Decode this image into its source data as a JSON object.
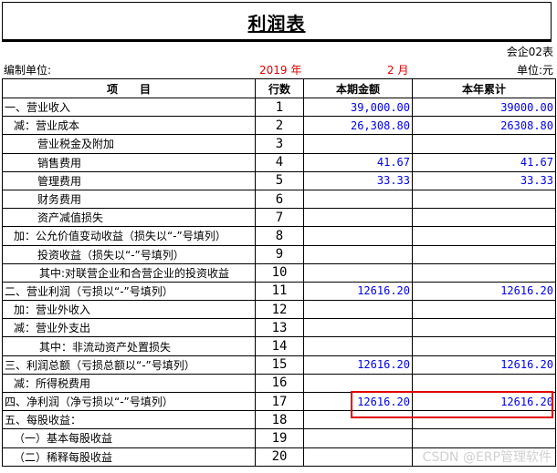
{
  "title": "利润表",
  "form_code": "会企02表",
  "meta": {
    "unit_label": "编制单位:",
    "year": "2019 年",
    "month": "2 月",
    "currency_unit": "单位:元"
  },
  "headers": [
    "项　　目",
    "行数",
    "本期金额",
    "本年累计"
  ],
  "rows": [
    {
      "item": "一、营业收入",
      "row": "1",
      "current": "39,000.00",
      "ytd": "39000.00",
      "indent": 0
    },
    {
      "item": "减：营业成本",
      "row": "2",
      "current": "26,308.80",
      "ytd": "26308.80",
      "indent": 1
    },
    {
      "item": "营业税金及附加",
      "row": "3",
      "current": "",
      "ytd": "",
      "indent": 2
    },
    {
      "item": "销售费用",
      "row": "4",
      "current": "41.67",
      "ytd": "41.67",
      "indent": 2
    },
    {
      "item": "管理费用",
      "row": "5",
      "current": "33.33",
      "ytd": "33.33",
      "indent": 2
    },
    {
      "item": "财务费用",
      "row": "6",
      "current": "",
      "ytd": "",
      "indent": 2
    },
    {
      "item": "资产减值损失",
      "row": "7",
      "current": "",
      "ytd": "",
      "indent": 2
    },
    {
      "item": "加：公允价值变动收益（损失以“-”号填列）",
      "row": "8",
      "current": "",
      "ytd": "",
      "indent": 1
    },
    {
      "item": "投资收益（损失以“-”号填列）",
      "row": "9",
      "current": "",
      "ytd": "",
      "indent": 2
    },
    {
      "item": "其中:对联营企业和合营企业的投资收益",
      "row": "10",
      "current": "",
      "ytd": "",
      "indent": 3
    },
    {
      "item": "二、营业利润（亏损以“-”号填列）",
      "row": "11",
      "current": "12616.20",
      "ytd": "12616.20",
      "indent": 0
    },
    {
      "item": "加：营业外收入",
      "row": "12",
      "current": "",
      "ytd": "",
      "indent": 1
    },
    {
      "item": "减：营业外支出",
      "row": "13",
      "current": "",
      "ytd": "",
      "indent": 1
    },
    {
      "item": "其中：非流动资产处置损失",
      "row": "14",
      "current": "",
      "ytd": "",
      "indent": 3
    },
    {
      "item": "三、利润总额（亏损总额以“-”号填列）",
      "row": "15",
      "current": "12616.20",
      "ytd": "12616.20",
      "indent": 0
    },
    {
      "item": "减：所得税费用",
      "row": "16",
      "current": "",
      "ytd": "",
      "indent": 1
    },
    {
      "item": "四、净利润（净亏损以“-”号填列）",
      "row": "17",
      "current": "12616.20",
      "ytd": "12616.20",
      "indent": 0
    },
    {
      "item": "五、每股收益：",
      "row": "18",
      "current": "",
      "ytd": "",
      "indent": 0
    },
    {
      "item": "（一）基本每股收益",
      "row": "19",
      "current": "",
      "ytd": "",
      "indent": 1
    },
    {
      "item": "（二）稀释每股收益",
      "row": "20",
      "current": "",
      "ytd": "",
      "indent": 1
    }
  ],
  "watermark": "CSDN @ERP管理软件",
  "colors": {
    "accent_red": "#e00000",
    "number_blue": "#0000ee"
  }
}
